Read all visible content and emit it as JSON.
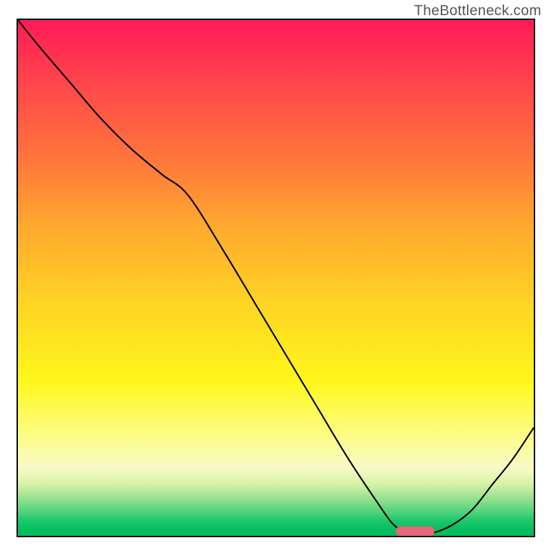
{
  "watermark": "TheBottleneck.com",
  "chart_data": {
    "type": "line",
    "title": "",
    "xlabel": "",
    "ylabel": "",
    "xlim": [
      0,
      100
    ],
    "ylim": [
      0,
      100
    ],
    "series": [
      {
        "name": "curve",
        "x": [
          0,
          4,
          10,
          16,
          22,
          28,
          33,
          40,
          46,
          52,
          58,
          64,
          70,
          73,
          76,
          80,
          84,
          88,
          92,
          96,
          100
        ],
        "y": [
          100,
          95,
          88,
          81,
          75,
          70,
          66,
          55,
          45,
          35,
          25,
          15,
          6,
          2,
          0.5,
          0.5,
          2,
          5,
          10,
          15,
          21
        ]
      },
      {
        "name": "marker",
        "type": "marker",
        "x": [
          77
        ],
        "y": [
          0.9
        ],
        "color": "#e4677a"
      }
    ],
    "note": "y is percent-of-height from bottom; background gradient runs red (top, high y) to green (bottom, low y). The curve descends from y=100 at x=0, has a knee near x≈30, bottoms out near x≈76–80, then rises again."
  }
}
